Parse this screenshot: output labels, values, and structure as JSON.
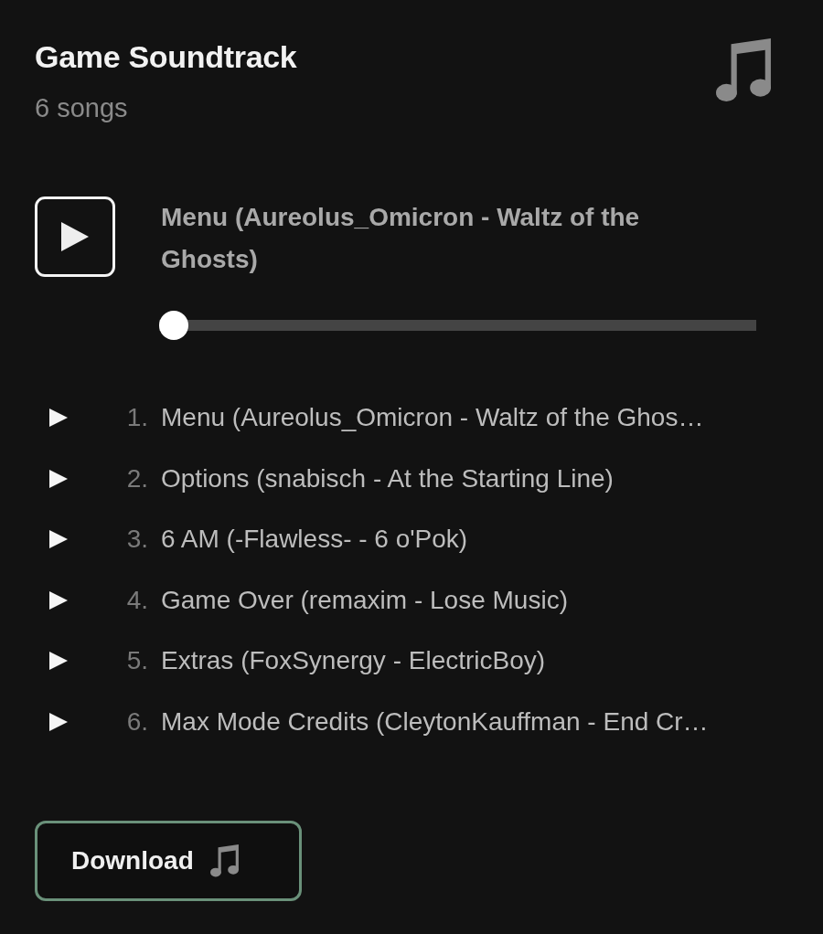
{
  "playlist": {
    "title": "Game Soundtrack",
    "count": "6 songs"
  },
  "player": {
    "now_playing": "Menu (Aureolus_Omicron - Waltz of the Ghosts)",
    "playing": false,
    "level": 0
  },
  "tracks": [
    {
      "number": "1.",
      "title": "Menu (Aureolus_Omicron - Waltz of the Ghos…"
    },
    {
      "number": "2.",
      "title": "Options (snabisch - At the Starting Line)"
    },
    {
      "number": "3.",
      "title": "6 AM (-Flawless- - 6 o'Pok)"
    },
    {
      "number": "4.",
      "title": "Game Over (remaxim - Lose Music)"
    },
    {
      "number": "5.",
      "title": "Extras (FoxSynergy - ElectricBoy)"
    },
    {
      "number": "6.",
      "title": "Max Mode Credits (CleytonKauffman - End Cr…"
    }
  ],
  "download_button": {
    "label": "Download"
  }
}
